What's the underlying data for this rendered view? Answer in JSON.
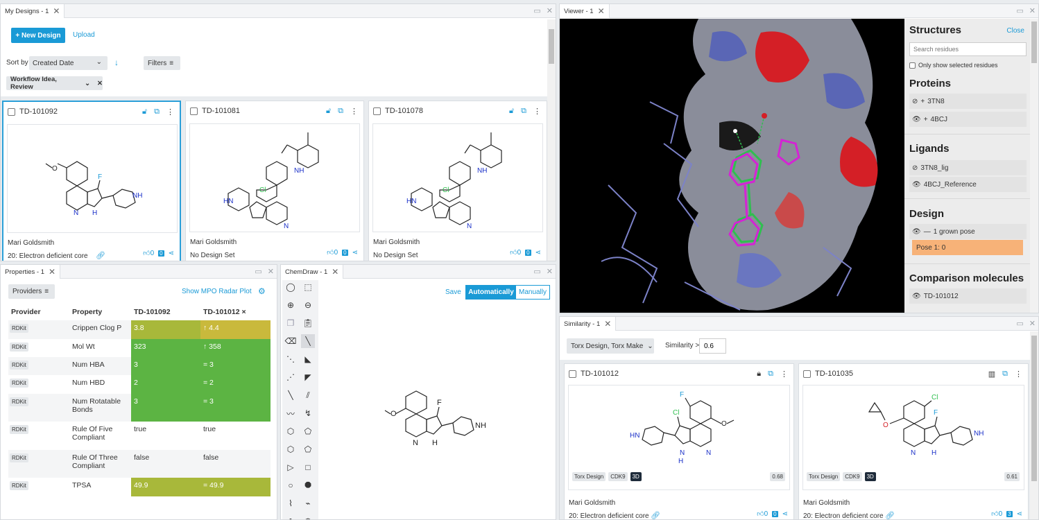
{
  "designs": {
    "tab": "My Designs - 1",
    "new_design": "+ New Design",
    "upload": "Upload",
    "sort_by_label": "Sort by",
    "sort_value": "Created Date",
    "filters": "Filters",
    "filter_chip": "Workflow Idea, Review",
    "cards": [
      {
        "id": "TD-101092",
        "author": "Mari Goldsmith",
        "set": "20: Electron deficient core",
        "likes": "0",
        "comments": "0"
      },
      {
        "id": "TD-101081",
        "author": "Mari Goldsmith",
        "set": "No Design Set",
        "likes": "0",
        "comments": "0"
      },
      {
        "id": "TD-101078",
        "author": "Mari Goldsmith",
        "set": "No Design Set",
        "likes": "0",
        "comments": "0"
      }
    ]
  },
  "viewer": {
    "tab": "Viewer - 1",
    "structures_title": "Structures",
    "close": "Close",
    "search_placeholder": "Search residues",
    "only_selected": "Only show selected residues",
    "proteins_title": "Proteins",
    "proteins": [
      "3TN8",
      "4BCJ"
    ],
    "ligands_title": "Ligands",
    "ligands": [
      "3TN8_lig",
      "4BCJ_Reference"
    ],
    "design_title": "Design",
    "design_items": [
      "1 grown pose"
    ],
    "pose": "Pose 1: 0",
    "comparison_title": "Comparison molecules",
    "comparison": [
      "TD-101012"
    ],
    "colors": {
      "pose_bg": "#f7b278",
      "carbon_green": "#2fbf4f",
      "carbon_magenta": "#d424d4"
    }
  },
  "properties": {
    "tab": "Properties - 1",
    "providers": "Providers",
    "show_radar": "Show MPO Radar Plot",
    "headers": {
      "provider": "Provider",
      "property": "Property",
      "col1": "TD-101092",
      "col2": "TD-101012 ×"
    },
    "rows": [
      {
        "provider": "RDKit",
        "property": "Crippen Clog P",
        "v1": "3.8",
        "v2": "↑ 4.4"
      },
      {
        "provider": "RDKit",
        "property": "Mol Wt",
        "v1": "323",
        "v2": "↑ 358"
      },
      {
        "provider": "RDKit",
        "property": "Num HBA",
        "v1": "3",
        "v2": "= 3"
      },
      {
        "provider": "RDKit",
        "property": "Num HBD",
        "v1": "2",
        "v2": "= 2"
      },
      {
        "provider": "RDKit",
        "property": "Num Rotatable Bonds",
        "v1": "3",
        "v2": "= 3"
      },
      {
        "provider": "RDKit",
        "property": "Rule Of Five Compliant",
        "v1": "true",
        "v2": "true"
      },
      {
        "provider": "RDKit",
        "property": "Rule Of Three Compliant",
        "v1": "false",
        "v2": "false"
      },
      {
        "provider": "RDKit",
        "property": "TPSA",
        "v1": "49.9",
        "v2": "= 49.9"
      }
    ]
  },
  "chemdraw": {
    "tab": "ChemDraw - 1",
    "save": "Save",
    "automatically": "Automatically",
    "manually": "Manually"
  },
  "similarity": {
    "tab": "Similarity - 1",
    "filter": "Torx Design, Torx Make",
    "similarity_label": "Similarity >",
    "similarity_value": "0.6",
    "cards": [
      {
        "id": "TD-101012",
        "tags": [
          "Torx Design",
          "CDK9",
          "3D"
        ],
        "score": "0.68",
        "author": "Mari Goldsmith",
        "set": "20: Electron deficient core",
        "likes": "0",
        "comments": "0"
      },
      {
        "id": "TD-101035",
        "tags": [
          "Torx Design",
          "CDK9",
          "3D"
        ],
        "score": "0.61",
        "author": "Mari Goldsmith",
        "set": "20: Electron deficient core",
        "likes": "0",
        "comments": "3"
      }
    ]
  },
  "atoms": {
    "F": "F",
    "O": "O",
    "N": "N",
    "NH": "NH",
    "H": "H",
    "Cl": "Cl",
    "HN": "HN"
  }
}
